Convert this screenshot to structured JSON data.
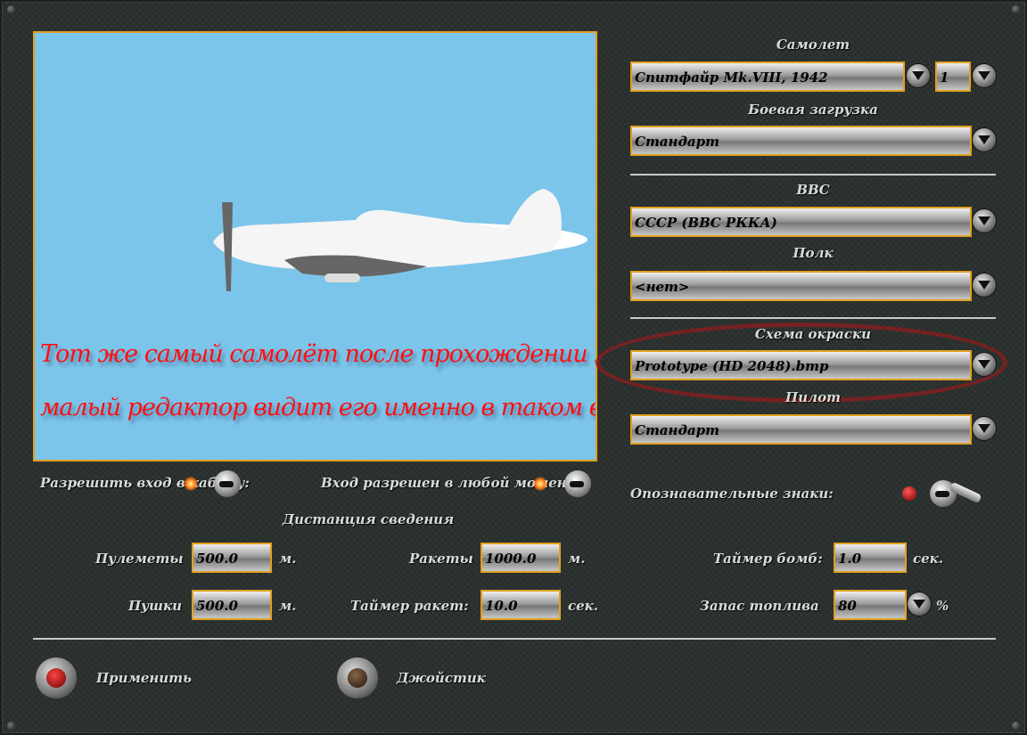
{
  "preview": {
    "note_line1": "Тот же самый самолёт после прохождении миссии",
    "note_line2": "малый редактор видит его именно в таком виде."
  },
  "aircraft": {
    "label": "Самолет",
    "value": "Спитфайр Mk.VIII, 1942",
    "count": "1"
  },
  "loadout": {
    "label": "Боевая загрузка",
    "value": "Стандарт"
  },
  "airforce": {
    "label": "ВВС",
    "value": "СССР (ВВС РККА)"
  },
  "regiment": {
    "label": "Полк",
    "value": "<нет>"
  },
  "skin": {
    "label": "Схема окраски",
    "value": "Prototype (HD 2048).bmp"
  },
  "pilot": {
    "label": "Пилот",
    "value": "Стандарт"
  },
  "options": {
    "allow_entry": "Разрешить вход в кабину:",
    "entry_any": "Вход разрешен в любой момент:",
    "markings": "Опознавательные знаки:"
  },
  "convergence": {
    "title": "Дистанция сведения",
    "mg_label": "Пулеметы",
    "mg_value": "500.0",
    "cannon_label": "Пушки",
    "cannon_value": "500.0",
    "m": "м.",
    "rockets_label": "Ракеты",
    "rockets_value": "1000.0",
    "rocket_timer_label": "Таймер ракет:",
    "rocket_timer_value": "10.0",
    "sec": "сек.",
    "bomb_timer_label": "Таймер бомб:",
    "bomb_timer_value": "1.0",
    "fuel_label": "Запас топлива",
    "fuel_value": "80",
    "percent": "%"
  },
  "buttons": {
    "apply": "Применить",
    "joystick": "Джойстик"
  }
}
